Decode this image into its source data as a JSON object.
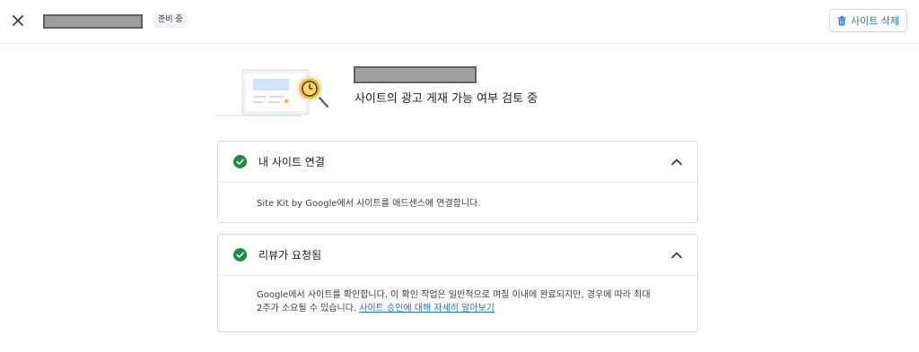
{
  "topbar": {
    "status_chip": "준비 중",
    "delete_button_label": "사이트 삭제"
  },
  "hero": {
    "review_text": "사이트의 광고 게재 가능 여부 검토 중"
  },
  "cards": [
    {
      "title": "내 사이트 연결",
      "body": "Site Kit by Google에서 사이트를 애드센스에 연결합니다."
    },
    {
      "title": "리뷰가 요청됨",
      "body": "Google에서 사이트를 확인합니다. 이 확인 작업은 일반적으로 며칠 이내에 완료되지만, 경우에 따라 최대 2주가 소요될 수 있습니다.",
      "link": "사이트 승인에 대해 자세히 알아보기"
    }
  ],
  "colors": {
    "accent": "#1a73e8",
    "success": "#1e8e3e",
    "redaction": "#9e9e9e"
  },
  "icons": [
    "close-icon",
    "trash-icon",
    "check-circle-icon",
    "chevron-up-icon",
    "magnifier-clock-icon"
  ]
}
